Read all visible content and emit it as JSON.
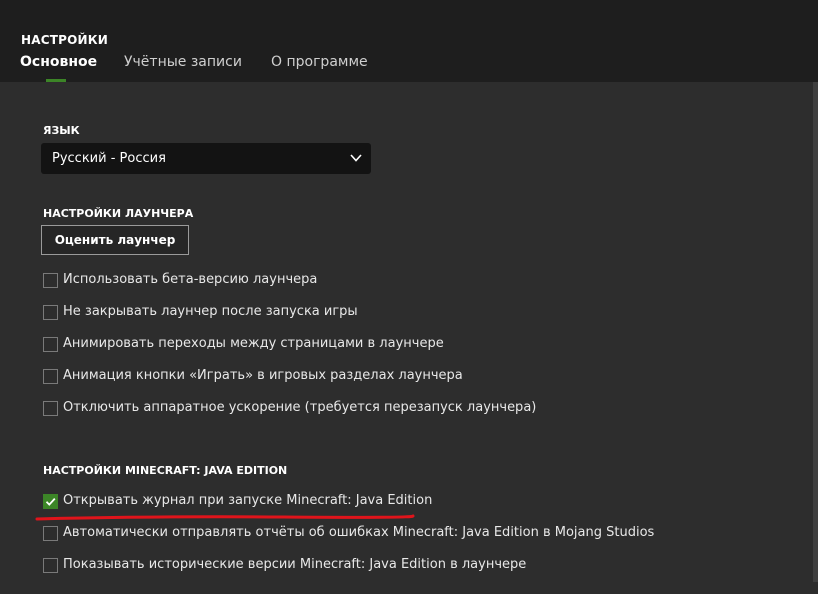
{
  "header": {
    "title": "НАСТРОЙКИ",
    "tabs": [
      {
        "label": "Основное",
        "active": true
      },
      {
        "label": "Учётные записи",
        "active": false
      },
      {
        "label": "О программе",
        "active": false
      }
    ]
  },
  "language": {
    "section_title": "ЯЗЫК",
    "selected": "Русский - Россия",
    "icon": "chevron-down-icon"
  },
  "launcher": {
    "section_title": "НАСТРОЙКИ ЛАУНЧЕРА",
    "rate_button": "Оценить лаунчер",
    "options": [
      {
        "label": "Использовать бета-версию лаунчера",
        "checked": false
      },
      {
        "label": "Не закрывать лаунчер после запуска игры",
        "checked": false
      },
      {
        "label": "Анимировать переходы между страницами в лаунчере",
        "checked": false
      },
      {
        "label": "Анимация кнопки «Играть» в игровых разделах лаунчера",
        "checked": false
      },
      {
        "label": "Отключить аппаратное ускорение (требуется перезапуск лаунчера)",
        "checked": false
      }
    ]
  },
  "minecraft": {
    "section_title": "НАСТРОЙКИ MINECRAFT: JAVA EDITION",
    "options": [
      {
        "label": "Открывать журнал при запуске Minecraft: Java Edition",
        "checked": true
      },
      {
        "label": "Автоматически отправлять отчёты об ошибках Minecraft: Java Edition в Mojang Studios",
        "checked": false
      },
      {
        "label": "Показывать исторические версии Minecraft: Java Edition в лаунчере",
        "checked": false
      }
    ]
  },
  "colors": {
    "accent": "#3c8527",
    "annotation": "#e0141b",
    "header_bg": "#1e1e1e",
    "content_bg": "#2d2d2d"
  }
}
